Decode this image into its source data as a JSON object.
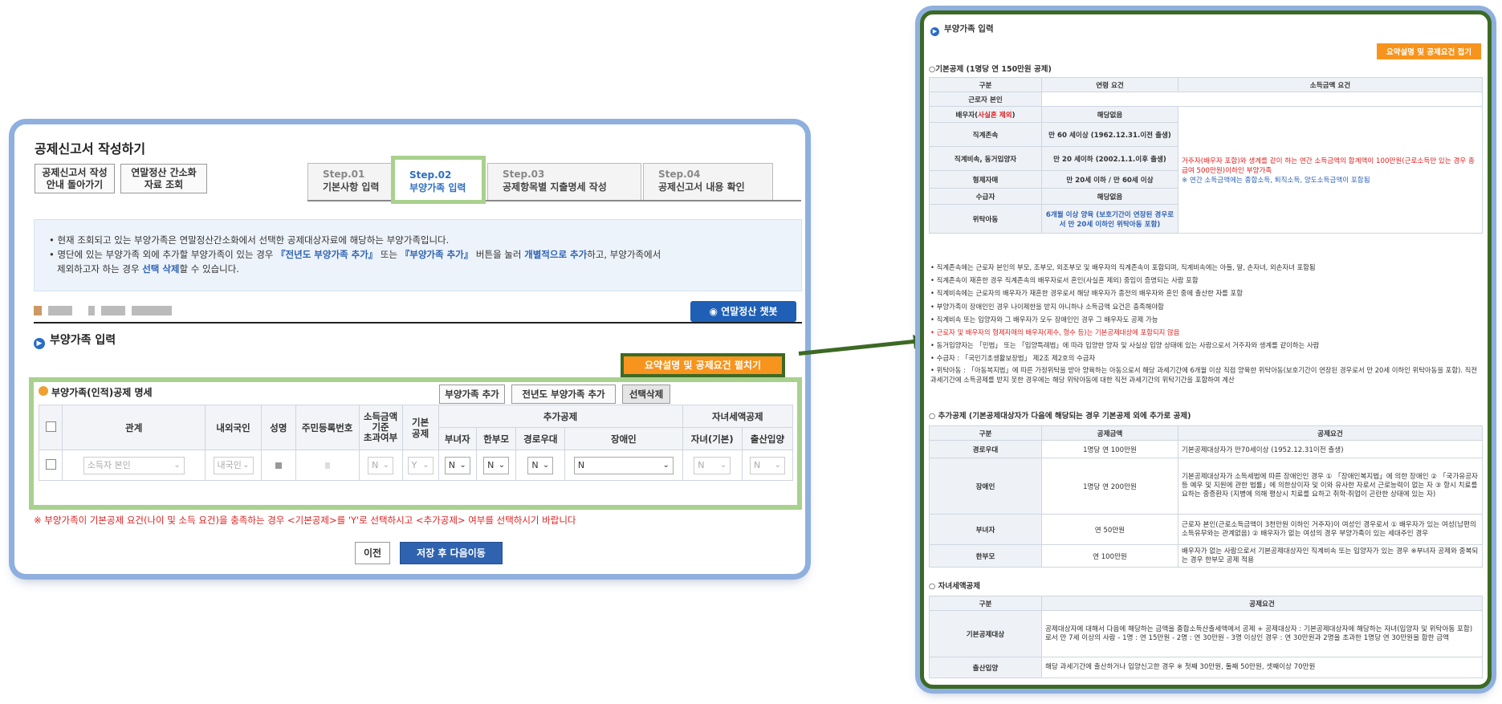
{
  "main": {
    "title": "공제신고서 작성하기",
    "guide_btn": [
      "공제신고서 작성",
      "안내 돌아가기"
    ],
    "simple_btn": [
      "연말정산 간소화",
      "자료 조회"
    ],
    "steps": [
      {
        "num": "Step.01",
        "label": "기본사항 입력"
      },
      {
        "num": "Step.02",
        "label": "부양가족 입력"
      },
      {
        "num": "Step.03",
        "label": "공제항목별 지출명세 작성"
      },
      {
        "num": "Step.04",
        "label": "공제신고서 내용 확인"
      }
    ],
    "notice": {
      "line1": "현재 조회되고 있는 부양가족은 연말정산간소화에서 선택한 공제대상자료에 해당하는 부양가족입니다.",
      "line2a": "명단에 있는 부양가족 외에 추가할 부양가족이 있는 경우 ",
      "line2b": "『전년도 부양가족 추가』",
      "line2c": " 또는 ",
      "line2d": "『부양가족 추가』",
      "line2e": " 버튼을 눌러 ",
      "line2f": "개별적으로 추가",
      "line2g": "하고, 부양가족에서",
      "line3a": "제외하고자 하는 경우 ",
      "line3b": "선택 삭제",
      "line3c": "할 수 있습니다."
    },
    "chatbot": "연말정산 챗봇",
    "section_title": "부양가족 입력",
    "expand_btn": "요약설명 및 공제요건 펼치기",
    "table_title": "부양가족(인적)공제 명세",
    "add_btn": "부양가족 추가",
    "prev_add_btn": "전년도 부양가족 추가",
    "delete_btn": "선택삭제",
    "headers": {
      "relation": "관계",
      "nation": "내외국인",
      "name": "성명",
      "rrn": "주민등록번호",
      "income": [
        "소득금액",
        "기준",
        "초과여부"
      ],
      "basic": [
        "기본",
        "공제"
      ],
      "extra": "추가공제",
      "child": "자녀세액공제",
      "woman": "부녀자",
      "single": "한부모",
      "elder": "경로우대",
      "disabled": "장애인",
      "child_basic": "자녀(기본)",
      "birth": "출산입양"
    },
    "row": {
      "relation": "소득자 본인",
      "nation": "내국인",
      "income": "N",
      "basic": "Y",
      "woman": "N",
      "single": "N",
      "elder": "N",
      "disabled": "N",
      "child_basic": "N",
      "birth": "N"
    },
    "warning": "※ 부양가족이 기본공제 요건(나이 및 소득 요건)을 충족하는 경우 <기본공제>를 'Y'로 선택하시고 <추가공제> 여부를 선택하시기 바랍니다",
    "prev_btn": "이전",
    "next_btn": "저장 후 다음이동"
  },
  "right": {
    "title": "부양가족 입력",
    "close_btn": "요약설명 및 공제요건 접기",
    "basic_title": "○기본공제 (1명당 연 150만원 공제)",
    "basic_head": [
      "구분",
      "연령 요건",
      "소득금액 요건"
    ],
    "basic_rows": [
      [
        "근로자 본인",
        ""
      ],
      [
        "배우자(사실혼 제외)",
        "해당없음"
      ],
      [
        "직계존속",
        "만 60 세이상 (1962.12.31.이전 출생)"
      ],
      [
        "직계비속, 동거입양자",
        "만 20 세이하 (2002.1.1.이후 출생)"
      ],
      [
        "형제자매",
        "만 20세 이하 / 만 60세 이상"
      ],
      [
        "수급자",
        "해당없음"
      ],
      [
        "위탁아동",
        "6개월 이상 양육 (보호기간이 연장된 경우로서 만 20세 이하인 위탁아동 포함)"
      ]
    ],
    "income_req": "거주자(배우자 포함)와 생계를 같이 하는 연간 소득금액의 합계액이 100만원(근로소득만 있는 경우 총급여 500만원)이하인 부양가족",
    "income_note": "※ 연간 소득금액에는 종합소득, 퇴직소득, 양도소득금액이 포함됨",
    "notes": [
      "직계존속에는 근로자 본인의 부모, 조부모, 외조부모 및 배우자의 직계존속이 포함되며, 직계비속에는 아들, 딸, 손자녀, 외손자녀 포함됨",
      "직계존속이 재혼한 경우 직계존속의 배우자로서 혼인(사실혼 제외) 중임이 증명되는 사람 포함",
      "직계비속에는 근로자의 배우자가 재혼한 경우로서 해당 배우자가 종전의 배우자와 혼인 중에 출산한 자를 포함",
      "부양가족이 장애인인 경우 나이제한을 받지 아니하나 소득금액 요건은 충족해야함",
      "직계비속 또는 입양자와 그 배우자가 모두 장애인인 경우 그 배우자도 공제 가능",
      "근로자 및 배우자의 형제자매의 배우자(제수, 형수 등)는 기본공제대상에 포함되지 않음",
      "동거입양자는 「민법」 또는 「입양특례법」에 따라 입양한 양자 및 사실상 입양 상태에 있는 사람으로서 거주자와 생계를 같이하는 사람",
      "수급자 : 「국민기초생활보장법」 제2조 제2호의 수급자",
      "위탁아동 : 「아동복지법」에 따른 가정위탁을 받아 양육하는 아동으로서 해당 과세기간에 6개월 이상 직접 양육한 위탁아동(보호기간이 연장된 경우로서 만 20세 이하인 위탁아동을 포함). 직전 과세기간에 소득공제를 받지 못한 경우에는 해당 위탁아동에 대한 직전 과세기간의 위탁기간을 포함하여 계산"
    ],
    "add_title": "○ 추가공제 (기본공제대상자가 다음에 해당되는 경우 기본공제 외에 추가로 공제)",
    "add_head": [
      "구분",
      "공제금액",
      "공제요건"
    ],
    "add_rows": [
      [
        "경로우대",
        "1명당 연 100만원",
        "기본공제대상자가 만70세이상 (1952.12.31이전 출생)"
      ],
      [
        "장애인",
        "1명당 연 200만원",
        "기본공제대상자가 소득세법에 따른 장애인인 경우 ① 「장애인복지법」에 의한 장애인 ② 「국가유공자 등 예우 및 지원에 관한 법률」에 의한상이자 및 이와 유사한 자로서 근로능력이 없는 자 ③ 항시 치료를 요하는 중증환자 (지병에 의해 평상시 치료를 요하고 취학·취업이 곤란한 상태에 있는 자)"
      ],
      [
        "부녀자",
        "연 50만원",
        "근로자 본인(근로소득금액이 3천만원 이하인 거주자)이 여성인 경우로서 ① 배우자가 있는 여성(남편의 소득유무와는 관계없음) ② 배우자가 없는 여성의 경우 부양가족이 있는 세대주인 경우"
      ],
      [
        "한부모",
        "연 100만원",
        "배우자가 없는 사람으로서 기본공제대상자인 직계비속 또는 입양자가 있는 경우 ※부녀자 공제와 중복되는 경우 한부모 공제 적용"
      ]
    ],
    "child_title": "○ 자녀세액공제",
    "child_head": [
      "구분",
      "공제요건"
    ],
    "child_rows": [
      [
        "기본공제대상",
        "공제대상자에 대해서 다음에 해당하는 금액을 종합소득산출세액에서 공제 + 공제대상자 : 기본공제대상자에 해당하는 자녀(입양자 및 위탁아동 포함)로서 만 7세 이상의 사람 - 1명 : 연 15만원 - 2명 : 연 30만원 - 3명 이상인 경우 : 연 30만원과 2명을 초과한 1명당 연 30만원을 합한 금액"
      ],
      [
        "출산입양",
        "해당 과세기간에 출산하거나 입양신고한 경우 ※ 첫째 30만원, 둘째 50만원, 셋째이상 70만원"
      ]
    ]
  }
}
